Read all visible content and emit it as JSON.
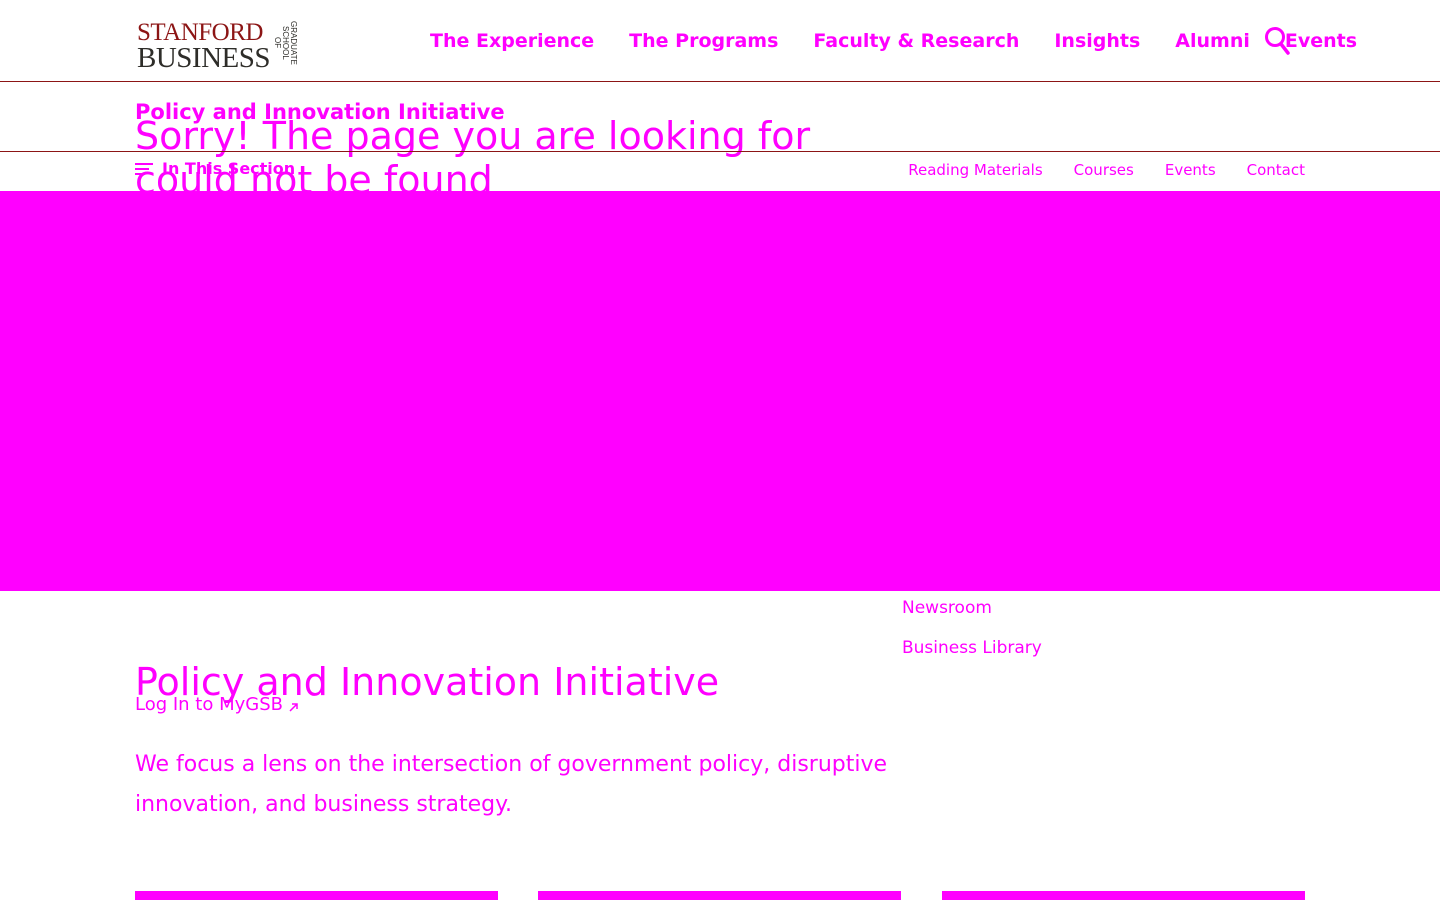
{
  "header": {
    "logo": {
      "line1": "STANFORD",
      "line2": "BUSINESS",
      "side": "GRADUATE SCHOOL OF"
    },
    "nav": [
      "The Experience",
      "The Programs",
      "Faculty & Research",
      "Insights",
      "Alumni",
      "Events"
    ],
    "search_icon": "search-icon"
  },
  "section": {
    "title": "Policy and Innovation Initiative",
    "in_this_section": "In This Section",
    "subnav": [
      "Reading Materials",
      "Courses",
      "Events",
      "Contact"
    ]
  },
  "error": {
    "message": "Sorry! The page you are looking for could not be found"
  },
  "utility_links": [
    "Newsroom",
    "Business Library"
  ],
  "main": {
    "title": "Policy and Innovation Initiative",
    "login": "Log In to MyGSB",
    "lede": "We focus a lens on the intersection of government policy, disruptive innovation, and business strategy."
  },
  "colors": {
    "brand": "#8c1515",
    "accent": "#ff00ff"
  }
}
